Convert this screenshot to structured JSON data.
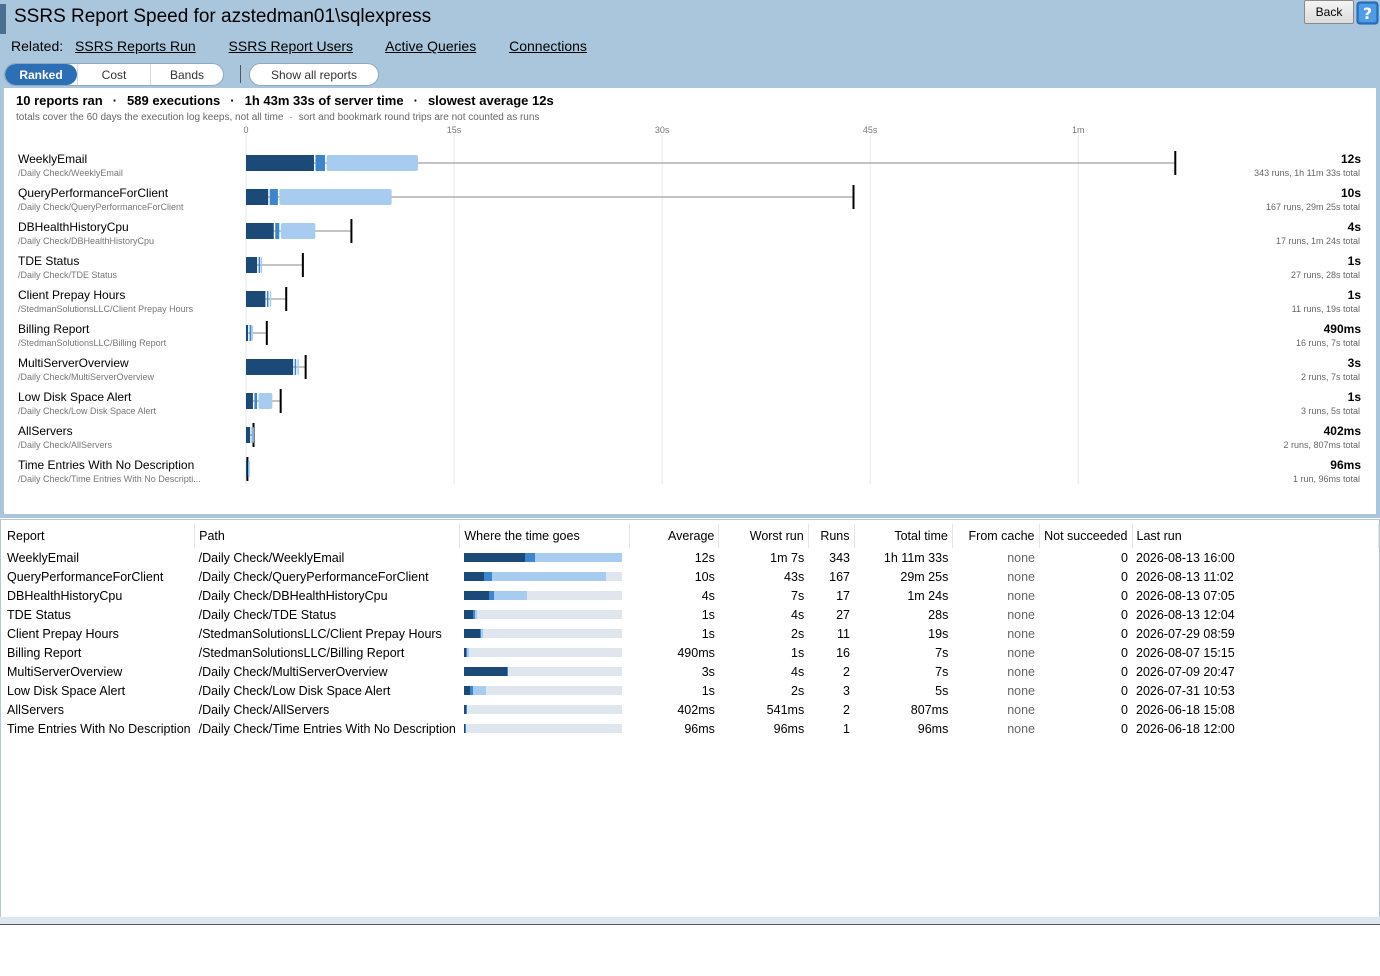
{
  "window": {
    "title": "SSRS Report Speed for azstedman01\\sqlexpress",
    "back_label": "Back"
  },
  "related": {
    "label": "Related:",
    "links": [
      "SSRS Reports Run",
      "SSRS Report Users",
      "Active Queries",
      "Connections"
    ]
  },
  "view_tabs": [
    "Ranked",
    "Cost",
    "Bands"
  ],
  "active_tab": "Ranked",
  "show_all_label": "Show all reports",
  "summary": {
    "parts": [
      "10 reports ran",
      "589 executions",
      "1h 43m 33s of server time",
      "slowest average 12s"
    ],
    "notes": [
      "totals cover the 60 days the execution log keeps, not all time",
      "sort and bookmark round trips are not counted as runs"
    ]
  },
  "colors": {
    "data_retrieval": "#1b4a78",
    "processing": "#3d85cf",
    "rendering": "#a8ccf0",
    "track": "#dfe6ee",
    "header_bg": "#a9c6dc"
  },
  "chart_data": {
    "type": "bar",
    "orientation": "horizontal-stacked",
    "x_unit": "seconds",
    "x_ticks": [
      {
        "value": 0,
        "label": "0"
      },
      {
        "value": 15,
        "label": "15s"
      },
      {
        "value": 30,
        "label": "30s"
      },
      {
        "value": 45,
        "label": "45s"
      },
      {
        "value": 60,
        "label": "1m"
      }
    ],
    "xlim": [
      0,
      80
    ],
    "grid": true,
    "rows": [
      {
        "name": "WeeklyEmail",
        "path": "/Daily Check/WeeklyEmail",
        "average": "12s",
        "detail": "343 runs, 1h 11m 33s total",
        "segments": [
          4.9,
          0.8,
          6.7
        ],
        "worst": 67
      },
      {
        "name": "QueryPerformanceForClient",
        "path": "/Daily Check/QueryPerformanceForClient",
        "average": "10s",
        "detail": "167 runs, 29m 25s total",
        "segments": [
          1.6,
          0.7,
          8.2
        ],
        "worst": 43.8
      },
      {
        "name": "DBHealthHistoryCpu",
        "path": "/Daily Check/DBHealthHistoryCpu",
        "average": "4s",
        "detail": "17 runs, 1m 24s total",
        "segments": [
          2.0,
          0.4,
          2.6
        ],
        "worst": 7.6
      },
      {
        "name": "TDE Status",
        "path": "/Daily Check/TDE Status",
        "average": "1s",
        "detail": "27 runs, 28s total",
        "segments": [
          0.8,
          0.15,
          0.2
        ],
        "worst": 4.1
      },
      {
        "name": "Client Prepay Hours",
        "path": "/StedmanSolutionsLLC/Client Prepay Hours",
        "average": "1s",
        "detail": "11 runs, 19s total",
        "segments": [
          1.4,
          0.2,
          0.2
        ],
        "worst": 2.9
      },
      {
        "name": "Billing Report",
        "path": "/StedmanSolutionsLLC/Billing Report",
        "average": "490ms",
        "detail": "16 runs, 7s total",
        "segments": [
          0.15,
          0.1,
          0.25
        ],
        "worst": 1.5
      },
      {
        "name": "MultiServerOverview",
        "path": "/Daily Check/MultiServerOverview",
        "average": "3s",
        "detail": "2 runs, 7s total",
        "segments": [
          3.4,
          0.2,
          0.1
        ],
        "worst": 4.3
      },
      {
        "name": "Low Disk Space Alert",
        "path": "/Daily Check/Low Disk Space Alert",
        "average": "1s",
        "detail": "3 runs, 5s total",
        "segments": [
          0.5,
          0.3,
          1.1
        ],
        "worst": 2.5
      },
      {
        "name": "AllServers",
        "path": "/Daily Check/AllServers",
        "average": "402ms",
        "detail": "2 runs, 807ms total",
        "segments": [
          0.3,
          0.05,
          0.05
        ],
        "worst": 0.54
      },
      {
        "name": "Time Entries With No Description",
        "path": "/Daily Check/Time Entries With No Descripti...",
        "average": "96ms",
        "detail": "1 run, 96ms total",
        "segments": [
          0.04,
          0.02,
          0.04
        ],
        "worst": 0.1
      }
    ]
  },
  "table": {
    "columns": [
      "Report",
      "Path",
      "Where the time goes",
      "Average",
      "Worst run",
      "Runs",
      "Total time",
      "From cache",
      "Not succeeded",
      "Last run"
    ],
    "rows": [
      {
        "report": "WeeklyEmail",
        "path": "/Daily Check/WeeklyEmail",
        "mix": [
          0.39,
          0.06,
          0.55
        ],
        "average": "12s",
        "worst": "1m 7s",
        "runs": "343",
        "total": "1h 11m 33s",
        "cache": "none",
        "failed": "0",
        "last": "2026-08-13 16:00"
      },
      {
        "report": "QueryPerformanceForClient",
        "path": "/Daily Check/QueryPerformanceForClient",
        "mix": [
          0.13,
          0.05,
          0.72
        ],
        "average": "10s",
        "worst": "43s",
        "runs": "167",
        "total": "29m 25s",
        "cache": "none",
        "failed": "0",
        "last": "2026-08-13 11:02"
      },
      {
        "report": "DBHealthHistoryCpu",
        "path": "/Daily Check/DBHealthHistoryCpu",
        "mix": [
          0.16,
          0.03,
          0.21
        ],
        "average": "4s",
        "worst": "7s",
        "runs": "17",
        "total": "1m 24s",
        "cache": "none",
        "failed": "0",
        "last": "2026-08-13 07:05"
      },
      {
        "report": "TDE Status",
        "path": "/Daily Check/TDE Status",
        "mix": [
          0.06,
          0.01,
          0.01
        ],
        "average": "1s",
        "worst": "4s",
        "runs": "27",
        "total": "28s",
        "cache": "none",
        "failed": "0",
        "last": "2026-08-13 12:04"
      },
      {
        "report": "Client Prepay Hours",
        "path": "/StedmanSolutionsLLC/Client Prepay Hours",
        "mix": [
          0.1,
          0.01,
          0.01
        ],
        "average": "1s",
        "worst": "2s",
        "runs": "11",
        "total": "19s",
        "cache": "none",
        "failed": "0",
        "last": "2026-07-29 08:59"
      },
      {
        "report": "Billing Report",
        "path": "/StedmanSolutionsLLC/Billing Report",
        "mix": [
          0.012,
          0.008,
          0.012
        ],
        "average": "490ms",
        "worst": "1s",
        "runs": "16",
        "total": "7s",
        "cache": "none",
        "failed": "0",
        "last": "2026-08-07 15:15"
      },
      {
        "report": "MultiServerOverview",
        "path": "/Daily Check/MultiServerOverview",
        "mix": [
          0.27,
          0.01,
          0.0
        ],
        "average": "3s",
        "worst": "4s",
        "runs": "2",
        "total": "7s",
        "cache": "none",
        "failed": "0",
        "last": "2026-07-09 20:47"
      },
      {
        "report": "Low Disk Space Alert",
        "path": "/Daily Check/Low Disk Space Alert",
        "mix": [
          0.04,
          0.02,
          0.08
        ],
        "average": "1s",
        "worst": "2s",
        "runs": "3",
        "total": "5s",
        "cache": "none",
        "failed": "0",
        "last": "2026-07-31 10:53"
      },
      {
        "report": "AllServers",
        "path": "/Daily Check/AllServers",
        "mix": [
          0.015,
          0.005,
          0.0
        ],
        "average": "402ms",
        "worst": "541ms",
        "runs": "2",
        "total": "807ms",
        "cache": "none",
        "failed": "0",
        "last": "2026-06-18 15:08"
      },
      {
        "report": "Time Entries With No Description",
        "path": "/Daily Check/Time Entries With No Description",
        "mix": [
          0.008,
          0.004,
          0.0
        ],
        "average": "96ms",
        "worst": "96ms",
        "runs": "1",
        "total": "96ms",
        "cache": "none",
        "failed": "0",
        "last": "2026-06-18 12:00"
      }
    ]
  }
}
